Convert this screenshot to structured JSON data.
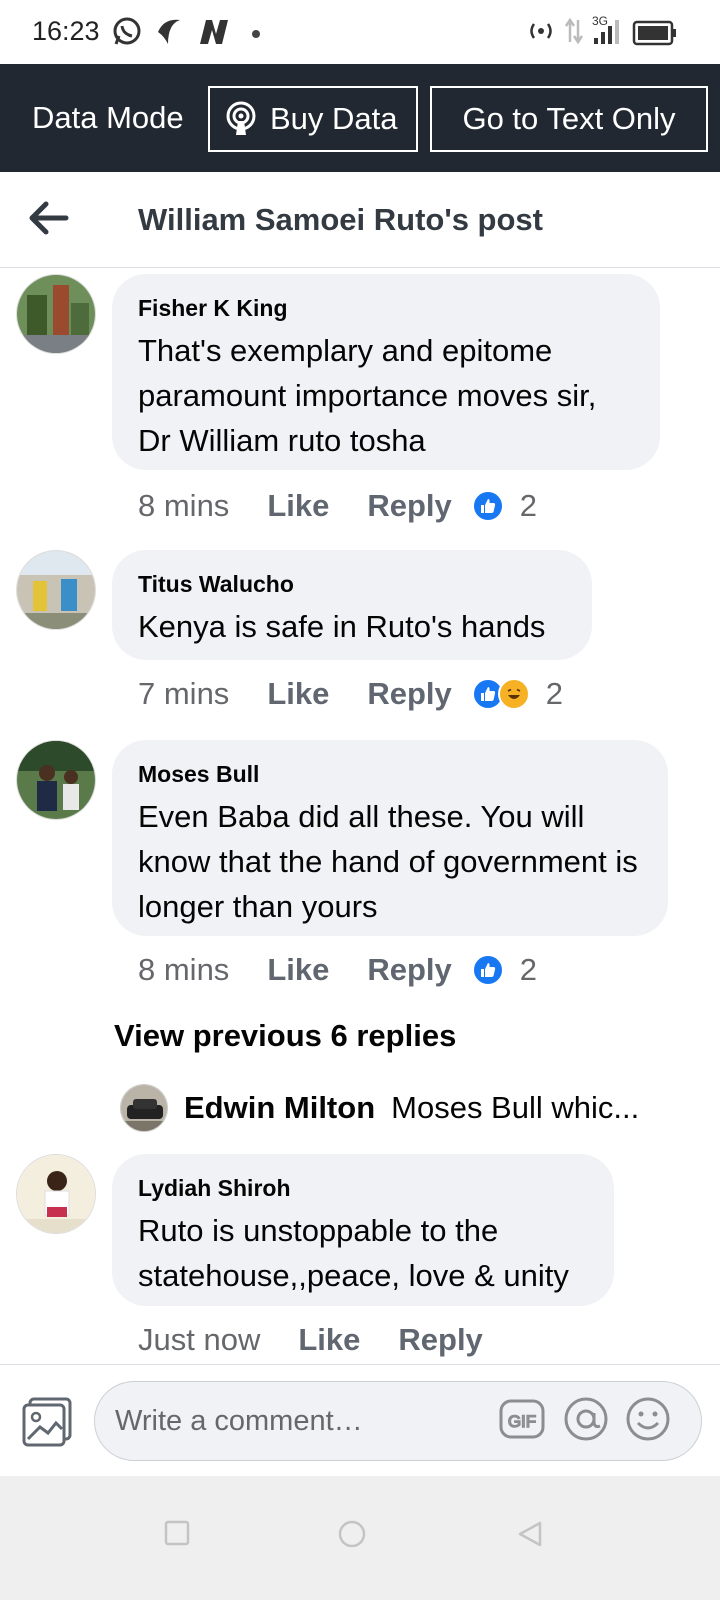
{
  "status_bar": {
    "time": "16:23",
    "network": "3G"
  },
  "data_mode": {
    "label": "Data Mode",
    "buy_data_label": "Buy Data",
    "text_only_label": "Go to Text Only"
  },
  "header": {
    "title": "William Samoei Ruto's post"
  },
  "comments": [
    {
      "name": "Fisher K King",
      "text": "That's exemplary and epitome paramount importance moves sir, Dr William ruto tosha",
      "time": "8 mins",
      "like": "Like",
      "reply": "Reply",
      "reactions": [
        "like-icon"
      ],
      "reaction_count": "2"
    },
    {
      "name": "Titus Walucho",
      "text": "Kenya is safe in Ruto's hands",
      "time": "7 mins",
      "like": "Like",
      "reply": "Reply",
      "reactions": [
        "like-icon",
        "haha-icon"
      ],
      "reaction_count": "2"
    },
    {
      "name": "Moses Bull",
      "text": "Even Baba did all these. You will know that the hand of government is longer than yours",
      "time": "8 mins",
      "like": "Like",
      "reply": "Reply",
      "reactions": [
        "like-icon"
      ],
      "reaction_count": "2"
    },
    {
      "name": "Lydiah Shiroh",
      "text": "Ruto is unstoppable to the statehouse,,peace, love & unity",
      "time": "Just now",
      "like": "Like",
      "reply": "Reply"
    }
  ],
  "replies": {
    "view_previous": "View previous 6 replies",
    "latest_name": "Edwin Milton",
    "latest_text": "Moses Bull whic..."
  },
  "composer": {
    "placeholder": "Write a comment…",
    "gif_label": "GIF"
  },
  "colors": {
    "accent": "#1877f2",
    "bubble": "#f0f2f5",
    "data_bar": "#222831",
    "haha": "#f7b125"
  }
}
